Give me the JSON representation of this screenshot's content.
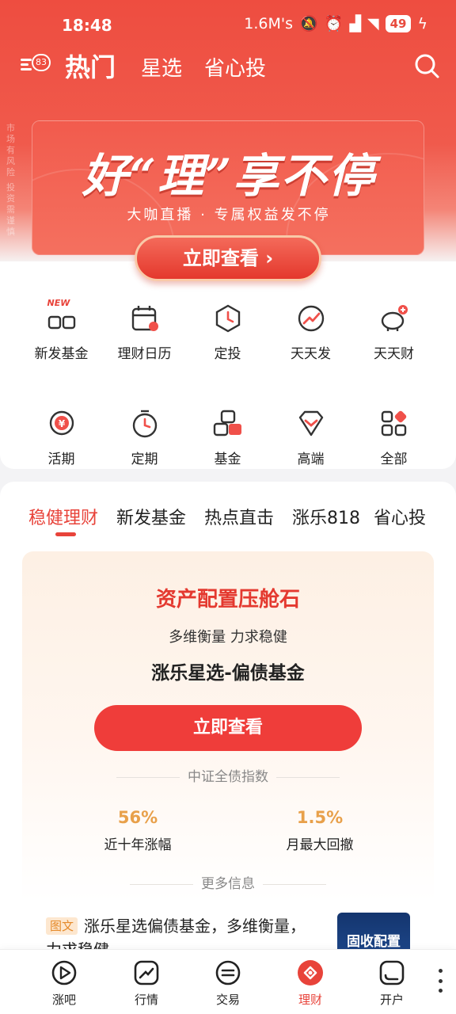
{
  "status_bar": {
    "time": "18:48",
    "net_speed": "1.6M's",
    "battery": "49"
  },
  "top_nav": {
    "menu_badge": "83",
    "tabs": [
      "热门",
      "星选",
      "省心投"
    ]
  },
  "side_notice": [
    "市场有风险",
    "投资需谨慎"
  ],
  "banner": {
    "title": "好“理”享不停",
    "subtitle": "大咖直播 · 专属权益发不停",
    "button": "立即查看 ›"
  },
  "shortcuts": {
    "new_tag": "NEW",
    "items": [
      {
        "label": "新发基金",
        "icon": "new-fund-icon"
      },
      {
        "label": "理财日历",
        "icon": "calendar-icon"
      },
      {
        "label": "定投",
        "icon": "fixed-invest-icon"
      },
      {
        "label": "天天发",
        "icon": "trend-icon"
      },
      {
        "label": "天天财",
        "icon": "piggy-bank-icon"
      },
      {
        "label": "活期",
        "icon": "yuan-coin-icon"
      },
      {
        "label": "定期",
        "icon": "timer-icon"
      },
      {
        "label": "基金",
        "icon": "fund-blocks-icon"
      },
      {
        "label": "高端",
        "icon": "diamond-icon"
      },
      {
        "label": "全部",
        "icon": "grid-icon"
      }
    ]
  },
  "content_tabs": [
    "稳健理财",
    "新发基金",
    "热点直击",
    "涨乐818",
    "省心投"
  ],
  "card": {
    "title": "资产配置压舱石",
    "subtitle": "多维衡量 力求稳健",
    "product_name": "涨乐星选-偏债基金",
    "button": "立即查看",
    "index_label": "中证全债指数",
    "stats": [
      {
        "value": "56%",
        "label": "近十年涨幅"
      },
      {
        "value": "1.5%",
        "label": "月最大回撤"
      }
    ],
    "more_label": "更多信息",
    "info": {
      "tag": "图文",
      "text": "涨乐星选偏债基金，多维衡量，力求稳健",
      "thumb_text": "固收配置"
    }
  },
  "tab_bar": [
    {
      "label": "涨吧",
      "icon": "play-circle-icon"
    },
    {
      "label": "行情",
      "icon": "chart-icon"
    },
    {
      "label": "交易",
      "icon": "transfer-icon"
    },
    {
      "label": "理财",
      "icon": "wealth-icon"
    },
    {
      "label": "开户",
      "icon": "account-icon"
    }
  ],
  "colors": {
    "brand_red": "#e8433a",
    "accent_gold": "#e8a04a"
  }
}
